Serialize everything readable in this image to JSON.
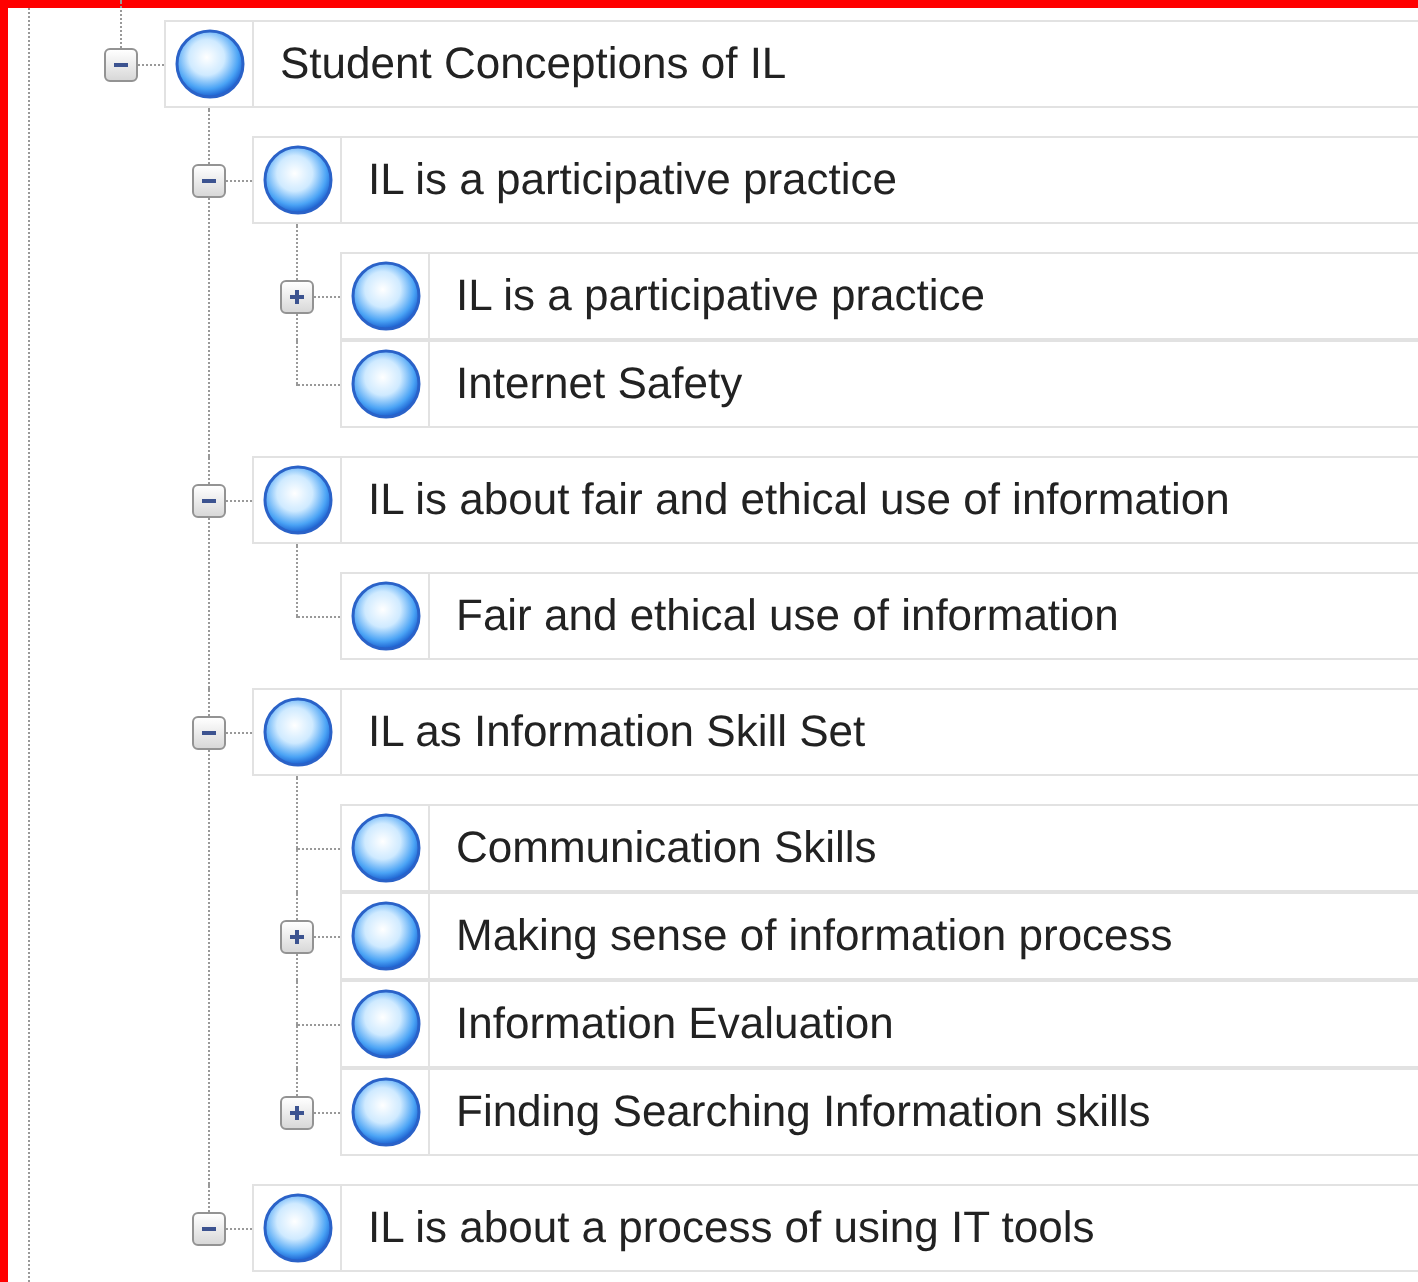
{
  "tree": {
    "nodes": [
      {
        "label": "Student Conceptions of IL",
        "expanded": true,
        "children": [
          {
            "label": "IL is a participative practice",
            "expanded": true,
            "children": [
              {
                "label": "IL is a participative practice",
                "expanded": false
              },
              {
                "label": "Internet Safety"
              }
            ]
          },
          {
            "label": "IL is about fair and ethical use of information",
            "expanded": true,
            "children": [
              {
                "label": "Fair and ethical use of information"
              }
            ]
          },
          {
            "label": "IL as Information Skill Set",
            "expanded": true,
            "children": [
              {
                "label": "Communication Skills"
              },
              {
                "label": "Making sense of information process",
                "expanded": false
              },
              {
                "label": "Information Evaluation"
              },
              {
                "label": "Finding Searching Information skills",
                "expanded": false
              }
            ]
          },
          {
            "label": "IL is about a process of using IT tools",
            "expanded": true
          }
        ]
      }
    ]
  }
}
